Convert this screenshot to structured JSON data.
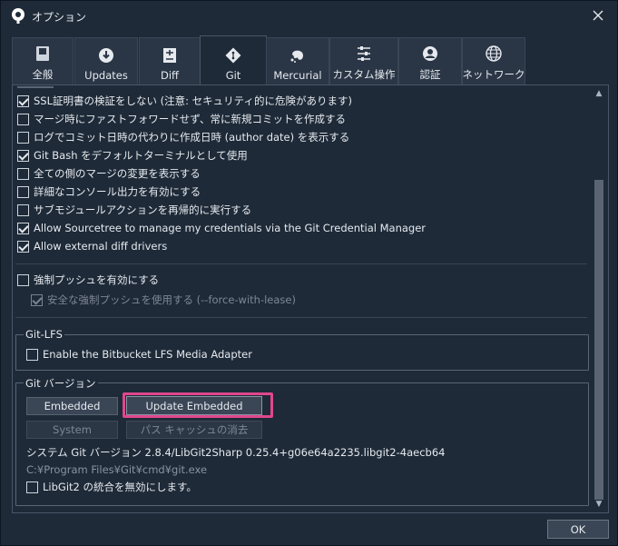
{
  "window": {
    "title": "オプション"
  },
  "tabs": [
    {
      "label": "全般",
      "icon": "toggle-switch-icon"
    },
    {
      "label": "Updates",
      "icon": "download-icon"
    },
    {
      "label": "Diff",
      "icon": "diff-icon"
    },
    {
      "label": "Git",
      "icon": "git-icon"
    },
    {
      "label": "Mercurial",
      "icon": "mercurial-icon"
    },
    {
      "label": "カスタム操作",
      "icon": "custom-actions-icon"
    },
    {
      "label": "認証",
      "icon": "user-icon"
    },
    {
      "label": "ネットワーク",
      "icon": "globe-icon"
    }
  ],
  "options": [
    {
      "label": "SSL証明書の検証をしない (注意: セキュリティ的に危険があります)",
      "checked": true
    },
    {
      "label": "マージ時にファストフォワードせず、常に新規コミットを作成する",
      "checked": false
    },
    {
      "label": "ログでコミット日時の代わりに作成日時 (author date) を表示する",
      "checked": false
    },
    {
      "label": "Git Bash をデフォルトターミナルとして使用",
      "checked": true
    },
    {
      "label": "全ての側のマージの変更を表示する",
      "checked": false
    },
    {
      "label": "詳細なコンソール出力を有効にする",
      "checked": false
    },
    {
      "label": "サブモジュールアクションを再帰的に実行する",
      "checked": false
    },
    {
      "label": "Allow Sourcetree to manage my credentials via the Git Credential Manager",
      "checked": true
    },
    {
      "label": "Allow external diff drivers",
      "checked": true
    }
  ],
  "force_push": {
    "label": "強制プッシュを有効にする",
    "checked": false,
    "safe_label": "安全な強制プッシュを使用する (--force-with-lease)",
    "safe_checked": true
  },
  "git_lfs": {
    "title": "Git-LFS",
    "adapter_label": "Enable the Bitbucket LFS Media Adapter",
    "adapter_checked": false
  },
  "git_version": {
    "title": "Git バージョン",
    "embedded_button": "Embedded",
    "update_embedded_button": "Update Embedded",
    "system_button": "System",
    "clear_cache_button": "パス キャッシュの消去",
    "version_text": "システム Git バージョン 2.8.4/LibGit2Sharp 0.25.4+g06e64a2235.libgit2-4aecb64",
    "path_text": "C:¥Program Files¥Git¥cmd¥git.exe",
    "disable_libgit2_label": "LibGit2 の統合を無効にします。",
    "disable_libgit2_checked": false
  },
  "footer": {
    "ok_button": "OK"
  },
  "colors": {
    "highlight": "#e0468e",
    "background": "#1e2a38"
  }
}
